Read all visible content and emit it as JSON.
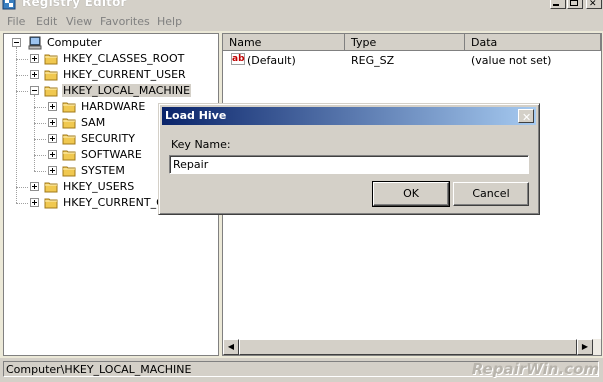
{
  "window": {
    "title": "Registry Editor"
  },
  "menu": [
    "File",
    "Edit",
    "View",
    "Favorites",
    "Help"
  ],
  "tree": {
    "root": "Computer",
    "items": [
      {
        "label": "HKEY_CLASSES_ROOT",
        "level": 1,
        "expander": "plus"
      },
      {
        "label": "HKEY_CURRENT_USER",
        "level": 1,
        "expander": "plus"
      },
      {
        "label": "HKEY_LOCAL_MACHINE",
        "level": 1,
        "expander": "minus",
        "selected": true
      },
      {
        "label": "HARDWARE",
        "level": 2,
        "expander": "plus"
      },
      {
        "label": "SAM",
        "level": 2,
        "expander": "plus"
      },
      {
        "label": "SECURITY",
        "level": 2,
        "expander": "plus"
      },
      {
        "label": "SOFTWARE",
        "level": 2,
        "expander": "plus"
      },
      {
        "label": "SYSTEM",
        "level": 2,
        "expander": "plus"
      },
      {
        "label": "HKEY_USERS",
        "level": 1,
        "expander": "plus"
      },
      {
        "label": "HKEY_CURRENT_C",
        "level": 1,
        "expander": "plus"
      }
    ]
  },
  "list": {
    "columns": [
      "Name",
      "Type",
      "Data"
    ],
    "rows": [
      {
        "icon": "string-value-icon",
        "name": "(Default)",
        "type": "REG_SZ",
        "data": "(value not set)"
      }
    ]
  },
  "status": "Computer\\HKEY_LOCAL_MACHINE",
  "watermark": "RepairWin.com",
  "dialog": {
    "title": "Load Hive",
    "key_label": "Key Name:",
    "key_value": "Repair",
    "ok_label": "OK",
    "cancel_label": "Cancel"
  },
  "colors": {
    "selection": "#d4d0c8",
    "dialog_title": "#0a246a",
    "folder": "#f0c850"
  }
}
